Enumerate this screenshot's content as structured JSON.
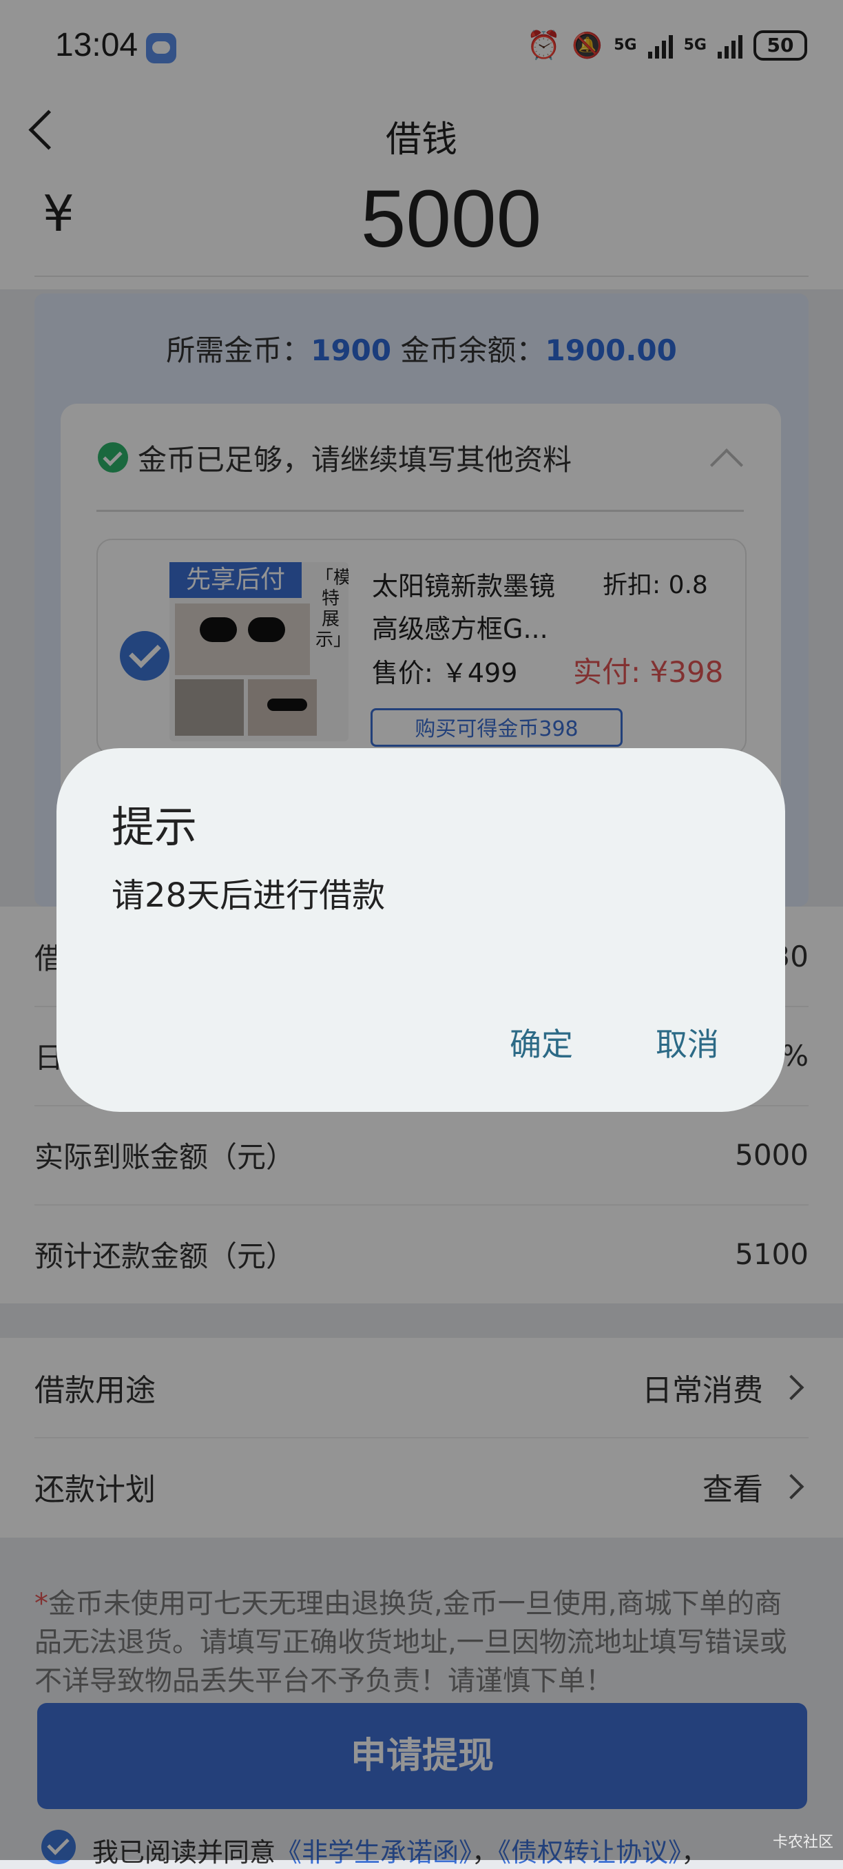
{
  "status_bar": {
    "time": "13:04",
    "battery": "50",
    "signal_label_1": "5G",
    "signal_label_2": "5G",
    "icons": [
      "message-icon",
      "alarm-icon",
      "mute-icon",
      "signal-icon",
      "signal-icon",
      "battery-icon"
    ]
  },
  "header": {
    "title": "借钱",
    "back_icon": "chevron-left-icon"
  },
  "amount": {
    "currency": "¥",
    "value": "5000"
  },
  "gold": {
    "required_label": "所需金币：",
    "required_value": "1900",
    "balance_label": "金币余额：",
    "balance_value": "1900.00",
    "enough_msg": "金币已足够，请继续填写其他资料"
  },
  "product": {
    "tag": "先享后付",
    "side_text": "「模特展示」",
    "name": "太阳镜新款墨镜高级感方框G...",
    "discount": "折扣: 0.8",
    "price": "售价: ￥499",
    "actual": "实付: ¥398",
    "buy_label": "购买可得金币398"
  },
  "info_rows": [
    {
      "label": "借",
      "value": "30"
    },
    {
      "label": "日",
      "value": "%"
    },
    {
      "label": "实际到账金额（元）",
      "value": "5000"
    },
    {
      "label": "预计还款金额（元）",
      "value": "5100"
    }
  ],
  "options": [
    {
      "label": "借款用途",
      "value": "日常消费"
    },
    {
      "label": "还款计划",
      "value": "查看"
    }
  ],
  "notice": {
    "star": "*",
    "text": "金币未使用可七天无理由退换货,金币一旦使用,商城下单的商品无法退货。请填写正确收货地址,一旦因物流地址填写错误或不详导致物品丢失平台不予负责！请谨慎下单！"
  },
  "submit_label": "申请提现",
  "agreement": {
    "prefix": "我已阅读并同意",
    "link1": "《非学生承诺函》",
    "sep": "，",
    "link2": "《债权转让协议》",
    "suffix": "，"
  },
  "watermark": "卡农社区",
  "dialog": {
    "title": "提示",
    "message": "请28天后进行借款",
    "ok_label": "确定",
    "cancel_label": "取消"
  },
  "colors": {
    "accent": "#3e6fd3",
    "danger": "#e05555",
    "dialog_button": "#2c6a86",
    "success": "#2db46b"
  }
}
